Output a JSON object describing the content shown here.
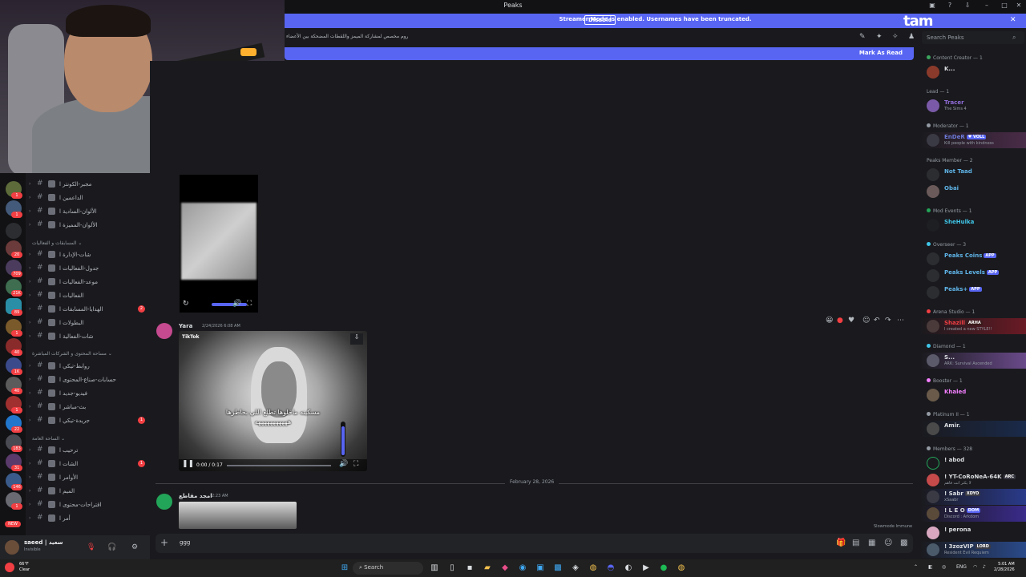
{
  "window": {
    "title": "Peaks"
  },
  "banner": {
    "message": "Streamer Mode is enabled. Usernames have been truncated.",
    "disable_label": "Disable"
  },
  "overlay_logo": "tam",
  "topic": {
    "text": "روم مخصص لمشاركة الميمز واللقطات المضحكة بين الأعضاء"
  },
  "search": {
    "placeholder": "Search Peaks"
  },
  "new_messages": {
    "label": "Mark As Read"
  },
  "channels": {
    "items": [
      {
        "name": "مجبر-الكونتر ا",
        "unread": ""
      },
      {
        "name": "الداعمين ا",
        "unread": ""
      },
      {
        "name": "الألوان-السادية ا",
        "unread": ""
      },
      {
        "name": "الألوان-المميزة ا",
        "unread": ""
      }
    ],
    "category1": "المسابقات و الفعاليات",
    "items2": [
      {
        "name": "شات-الإدارة ا",
        "unread": ""
      },
      {
        "name": "جدول-الفعاليات ا",
        "unread": ""
      },
      {
        "name": "موعد-الفعاليات ا",
        "unread": ""
      },
      {
        "name": "الفعاليات ا",
        "unread": ""
      },
      {
        "name": "الهدايا-المسابقات ا",
        "unread": "2"
      },
      {
        "name": "البطولات ا",
        "unread": ""
      },
      {
        "name": "شات-الفعالية ا",
        "unread": ""
      }
    ],
    "category2": "مساحة المحتوى و الشركات المباشرة",
    "items3": [
      {
        "name": "روابط-تيكي ا",
        "unread": ""
      },
      {
        "name": "حسابات-صناع-المحتوى ا",
        "unread": ""
      },
      {
        "name": "فيديو-جديد ا",
        "unread": ""
      },
      {
        "name": "بث-مباشر ا",
        "unread": ""
      },
      {
        "name": "جريدة-تيكي ا",
        "unread": "1"
      }
    ],
    "category3": "الساحة العامة",
    "items4": [
      {
        "name": "ترحيب ا",
        "unread": ""
      },
      {
        "name": "الشات ا",
        "unread": "1"
      },
      {
        "name": "الأوامر ا",
        "unread": ""
      },
      {
        "name": "الميم ا",
        "unread": ""
      },
      {
        "name": "اقتراحات-محتوى ا",
        "unread": ""
      },
      {
        "name": "أمر ا",
        "unread": ""
      }
    ]
  },
  "guild_badges": [
    "1",
    "1",
    "20",
    "709",
    "21K",
    "89",
    "1",
    "40",
    "1K",
    "40",
    "1",
    "22",
    "1",
    "183",
    "31",
    "146",
    "1",
    "NEW"
  ],
  "user": {
    "name": "saeed | سعيد",
    "status": "Invisible"
  },
  "messages": [
    {
      "author": "Yara",
      "timestamp": "2/24/2026 6:08 AM"
    },
    {
      "author": "امجد مقاطع",
      "timestamp": "2:23 AM"
    }
  ],
  "video": {
    "brand": "TikTok",
    "caption": "مسكينه ماخلوها تطلع اللي بخاطرها هههههههههههه",
    "time": "0:00 / 0:17"
  },
  "divider": {
    "date": "February 28, 2026"
  },
  "slowmode": "Slowmode Immune",
  "composer": {
    "text": "ggg"
  },
  "members": {
    "roles": {
      "content_creator": "Content Creator — 1",
      "lead": "Lead — 1",
      "moderator": "Moderator — 1",
      "peaks_member": "Peaks Member — 2",
      "mod_events": "Mod Events — 1",
      "overseer": "Overseer — 3",
      "arena_studio": "Arena Studio — 1",
      "diamond": "Diamond — 1",
      "booster": "Booster — 1",
      "platinum": "Platinum II — 1",
      "members": "Members — 328"
    },
    "list": {
      "k": {
        "name": "K...",
        "sub": ""
      },
      "tracer": {
        "name": "Tracer",
        "sub": "The Sims 4"
      },
      "ender": {
        "name": "EnDeR",
        "sub": "Kill people with kindness"
      },
      "not_taad": {
        "name": "Not Taad",
        "sub": ""
      },
      "obai": {
        "name": "Obai",
        "sub": ""
      },
      "shehulka": {
        "name": "SheHulka",
        "sub": ""
      },
      "peaks_coins": {
        "name": "Peaks Coins",
        "sub": "",
        "tag": "APP"
      },
      "peaks_levels": {
        "name": "Peaks Levels",
        "sub": "",
        "tag": "APP"
      },
      "peaks_plus": {
        "name": "Peaks+",
        "sub": "",
        "tag": "APP"
      },
      "shazill": {
        "name": "Shazill",
        "sub": "I created a new STYLE!!",
        "tag": "ARHA"
      },
      "s": {
        "name": "S...",
        "sub": "ARK: Survival Ascended"
      },
      "khaled": {
        "name": "Khaled",
        "sub": ""
      },
      "amir": {
        "name": "Amir.",
        "sub": ""
      },
      "abod": {
        "name": "! abod",
        "sub": ""
      },
      "corona": {
        "name": "! YT-CoRoNeA-64K",
        "sub": "لا يكثر انت فاهم",
        "tag": "ARC"
      },
      "sabr": {
        "name": "! Sabr",
        "sub": "xSaabr",
        "tag": "XDYO"
      },
      "leo": {
        "name": "! L E O",
        "sub": "Discord : Arkdom",
        "tag": "DOM"
      },
      "perona": {
        "name": "! perona",
        "sub": ""
      },
      "3zoz": {
        "name": "! 3zozVIP",
        "sub": "Resident Evil Requiem",
        "tag": "LORD"
      }
    }
  },
  "taskbar": {
    "search": "Search",
    "weather_temp": "66°F",
    "weather_desc": "Clear",
    "time": "5:01 AM",
    "date": "2/28/2026",
    "lang": "ENG"
  }
}
